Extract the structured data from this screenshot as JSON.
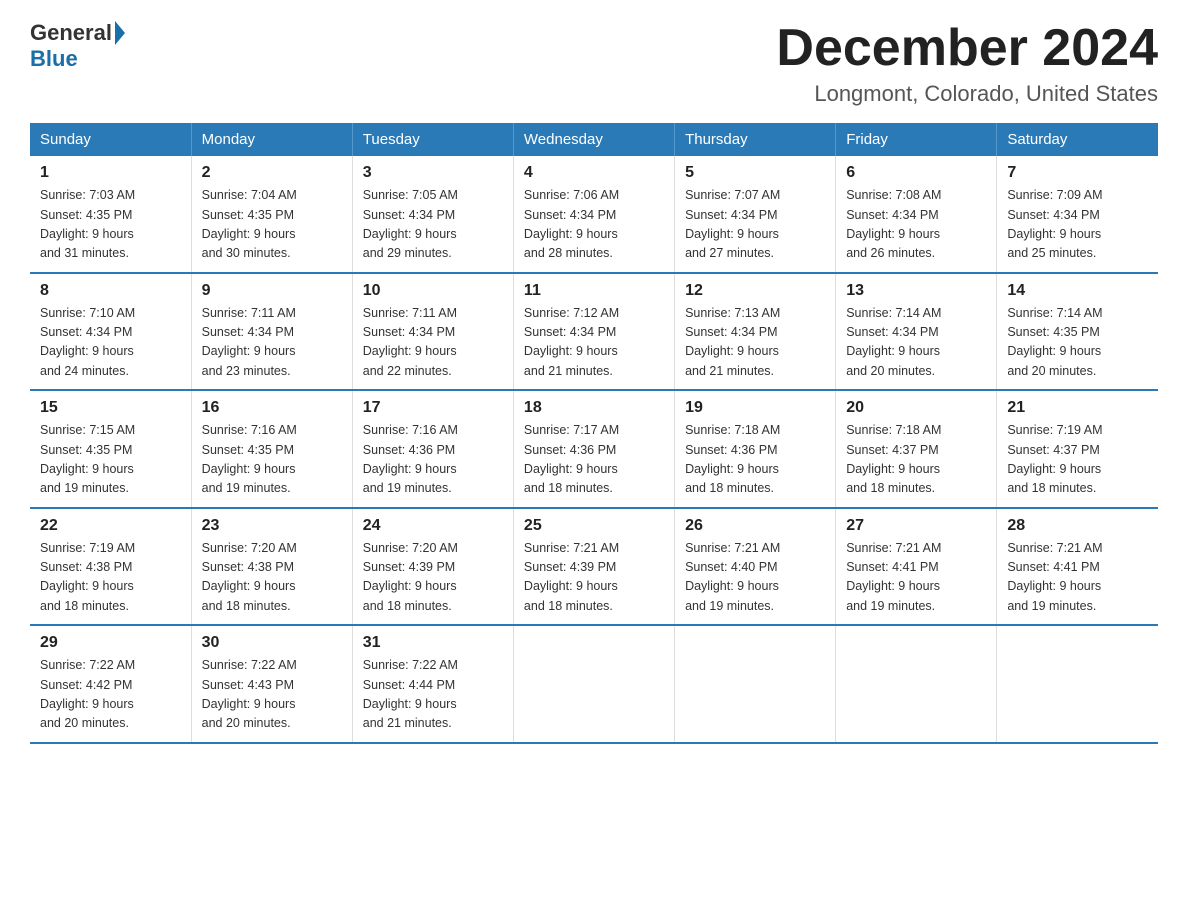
{
  "header": {
    "logo_general": "General",
    "logo_blue": "Blue",
    "month_title": "December 2024",
    "location": "Longmont, Colorado, United States"
  },
  "weekdays": [
    "Sunday",
    "Monday",
    "Tuesday",
    "Wednesday",
    "Thursday",
    "Friday",
    "Saturday"
  ],
  "weeks": [
    [
      {
        "day": "1",
        "sunrise": "7:03 AM",
        "sunset": "4:35 PM",
        "daylight": "9 hours and 31 minutes."
      },
      {
        "day": "2",
        "sunrise": "7:04 AM",
        "sunset": "4:35 PM",
        "daylight": "9 hours and 30 minutes."
      },
      {
        "day": "3",
        "sunrise": "7:05 AM",
        "sunset": "4:34 PM",
        "daylight": "9 hours and 29 minutes."
      },
      {
        "day": "4",
        "sunrise": "7:06 AM",
        "sunset": "4:34 PM",
        "daylight": "9 hours and 28 minutes."
      },
      {
        "day": "5",
        "sunrise": "7:07 AM",
        "sunset": "4:34 PM",
        "daylight": "9 hours and 27 minutes."
      },
      {
        "day": "6",
        "sunrise": "7:08 AM",
        "sunset": "4:34 PM",
        "daylight": "9 hours and 26 minutes."
      },
      {
        "day": "7",
        "sunrise": "7:09 AM",
        "sunset": "4:34 PM",
        "daylight": "9 hours and 25 minutes."
      }
    ],
    [
      {
        "day": "8",
        "sunrise": "7:10 AM",
        "sunset": "4:34 PM",
        "daylight": "9 hours and 24 minutes."
      },
      {
        "day": "9",
        "sunrise": "7:11 AM",
        "sunset": "4:34 PM",
        "daylight": "9 hours and 23 minutes."
      },
      {
        "day": "10",
        "sunrise": "7:11 AM",
        "sunset": "4:34 PM",
        "daylight": "9 hours and 22 minutes."
      },
      {
        "day": "11",
        "sunrise": "7:12 AM",
        "sunset": "4:34 PM",
        "daylight": "9 hours and 21 minutes."
      },
      {
        "day": "12",
        "sunrise": "7:13 AM",
        "sunset": "4:34 PM",
        "daylight": "9 hours and 21 minutes."
      },
      {
        "day": "13",
        "sunrise": "7:14 AM",
        "sunset": "4:34 PM",
        "daylight": "9 hours and 20 minutes."
      },
      {
        "day": "14",
        "sunrise": "7:14 AM",
        "sunset": "4:35 PM",
        "daylight": "9 hours and 20 minutes."
      }
    ],
    [
      {
        "day": "15",
        "sunrise": "7:15 AM",
        "sunset": "4:35 PM",
        "daylight": "9 hours and 19 minutes."
      },
      {
        "day": "16",
        "sunrise": "7:16 AM",
        "sunset": "4:35 PM",
        "daylight": "9 hours and 19 minutes."
      },
      {
        "day": "17",
        "sunrise": "7:16 AM",
        "sunset": "4:36 PM",
        "daylight": "9 hours and 19 minutes."
      },
      {
        "day": "18",
        "sunrise": "7:17 AM",
        "sunset": "4:36 PM",
        "daylight": "9 hours and 18 minutes."
      },
      {
        "day": "19",
        "sunrise": "7:18 AM",
        "sunset": "4:36 PM",
        "daylight": "9 hours and 18 minutes."
      },
      {
        "day": "20",
        "sunrise": "7:18 AM",
        "sunset": "4:37 PM",
        "daylight": "9 hours and 18 minutes."
      },
      {
        "day": "21",
        "sunrise": "7:19 AM",
        "sunset": "4:37 PM",
        "daylight": "9 hours and 18 minutes."
      }
    ],
    [
      {
        "day": "22",
        "sunrise": "7:19 AM",
        "sunset": "4:38 PM",
        "daylight": "9 hours and 18 minutes."
      },
      {
        "day": "23",
        "sunrise": "7:20 AM",
        "sunset": "4:38 PM",
        "daylight": "9 hours and 18 minutes."
      },
      {
        "day": "24",
        "sunrise": "7:20 AM",
        "sunset": "4:39 PM",
        "daylight": "9 hours and 18 minutes."
      },
      {
        "day": "25",
        "sunrise": "7:21 AM",
        "sunset": "4:39 PM",
        "daylight": "9 hours and 18 minutes."
      },
      {
        "day": "26",
        "sunrise": "7:21 AM",
        "sunset": "4:40 PM",
        "daylight": "9 hours and 19 minutes."
      },
      {
        "day": "27",
        "sunrise": "7:21 AM",
        "sunset": "4:41 PM",
        "daylight": "9 hours and 19 minutes."
      },
      {
        "day": "28",
        "sunrise": "7:21 AM",
        "sunset": "4:41 PM",
        "daylight": "9 hours and 19 minutes."
      }
    ],
    [
      {
        "day": "29",
        "sunrise": "7:22 AM",
        "sunset": "4:42 PM",
        "daylight": "9 hours and 20 minutes."
      },
      {
        "day": "30",
        "sunrise": "7:22 AM",
        "sunset": "4:43 PM",
        "daylight": "9 hours and 20 minutes."
      },
      {
        "day": "31",
        "sunrise": "7:22 AM",
        "sunset": "4:44 PM",
        "daylight": "9 hours and 21 minutes."
      },
      {
        "day": "",
        "sunrise": "",
        "sunset": "",
        "daylight": ""
      },
      {
        "day": "",
        "sunrise": "",
        "sunset": "",
        "daylight": ""
      },
      {
        "day": "",
        "sunrise": "",
        "sunset": "",
        "daylight": ""
      },
      {
        "day": "",
        "sunrise": "",
        "sunset": "",
        "daylight": ""
      }
    ]
  ],
  "labels": {
    "sunrise_prefix": "Sunrise: ",
    "sunset_prefix": "Sunset: ",
    "daylight_prefix": "Daylight: "
  }
}
